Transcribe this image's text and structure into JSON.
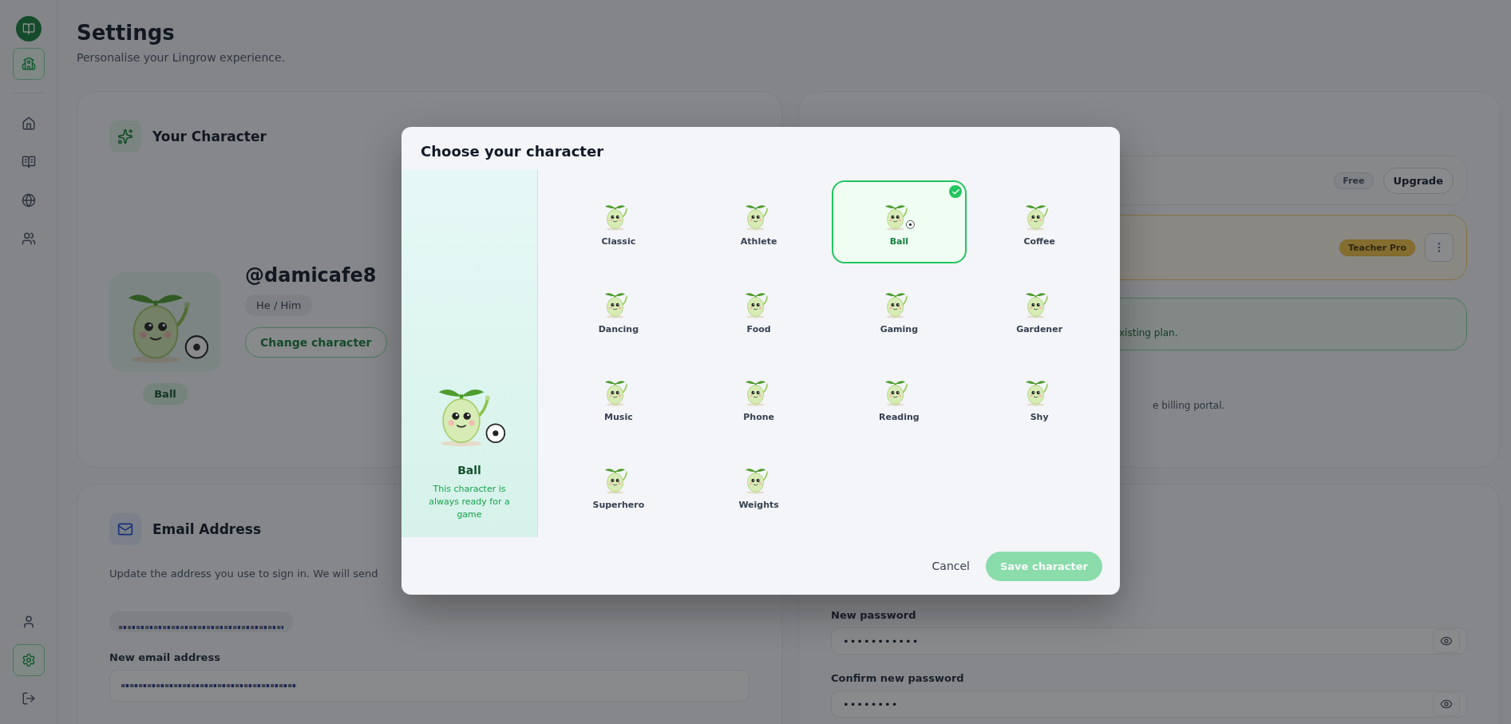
{
  "sidebar": {
    "workspace": {
      "selected": true
    },
    "nav_items": [
      {
        "selected": false
      },
      {
        "selected": false
      },
      {
        "selected": false
      },
      {
        "selected": false
      }
    ],
    "footer_items": [
      {
        "selected": false
      },
      {
        "selected": true
      },
      {
        "selected": false
      }
    ]
  },
  "header": {
    "title": "Settings",
    "subtitle": "Personalise your Lingrow experience."
  },
  "character_card": {
    "title": "Your Character",
    "character_name": "Ball",
    "username": "@damicafe8",
    "pronouns": "He / Him",
    "change_button": "Change character"
  },
  "subscription_card": {
    "current_plan": {
      "badge": "Free",
      "button": "Upgrade"
    },
    "active_plan": {
      "badge": "Teacher Pro"
    },
    "notice": "xisting plan.",
    "billing_text": "e billing portal."
  },
  "email_card": {
    "title": "Email Address",
    "description": "Update the address you use to sign in. We will send",
    "new_email_label": "New email address"
  },
  "password_card": {
    "fields": [
      {
        "label": "New password",
        "value": "•••••••••••"
      },
      {
        "label": "Confirm new password",
        "value": "••••••••"
      }
    ]
  },
  "modal": {
    "title": "Choose your character",
    "preview": {
      "name": "Ball",
      "description": "This character is always ready for a game"
    },
    "characters": [
      {
        "name": "Classic",
        "selected": false
      },
      {
        "name": "Athlete",
        "selected": false
      },
      {
        "name": "Ball",
        "selected": true
      },
      {
        "name": "Coffee",
        "selected": false
      },
      {
        "name": "Dancing",
        "selected": false
      },
      {
        "name": "Food",
        "selected": false
      },
      {
        "name": "Gaming",
        "selected": false
      },
      {
        "name": "Gardener",
        "selected": false
      },
      {
        "name": "Music",
        "selected": false
      },
      {
        "name": "Phone",
        "selected": false
      },
      {
        "name": "Reading",
        "selected": false
      },
      {
        "name": "Shy",
        "selected": false
      },
      {
        "name": "Superhero",
        "selected": false
      },
      {
        "name": "Weights",
        "selected": false
      }
    ],
    "cancel": "Cancel",
    "save": {
      "label": "Save character",
      "disabled": true
    }
  }
}
